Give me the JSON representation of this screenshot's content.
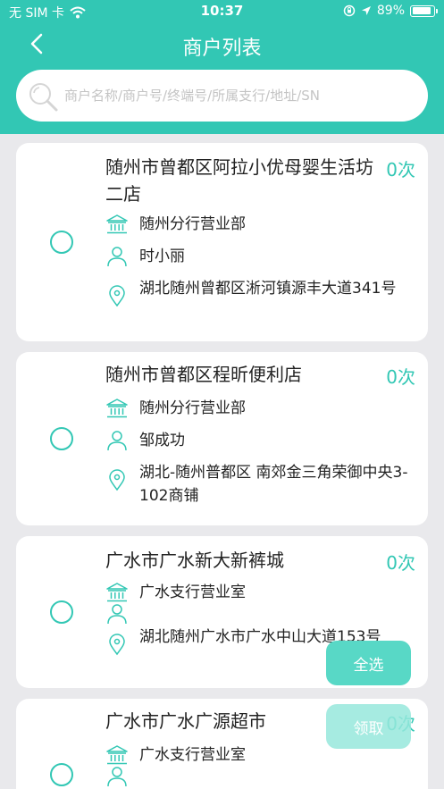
{
  "status_bar": {
    "carrier": "无 SIM 卡",
    "time": "10:37",
    "battery": "89%",
    "battery_level": 0.89
  },
  "nav": {
    "title": "商户列表",
    "back_icon": "chevron-left-icon"
  },
  "search": {
    "placeholder": "商户名称/商户号/终端号/所属支行/地址/SN",
    "value": ""
  },
  "merchants": [
    {
      "name": "随州市曾都区阿拉小优母婴生活坊二店",
      "count": "0次",
      "branch": "随州分行营业部",
      "contact": "时小丽",
      "address": "湖北随州曾都区淅河镇源丰大道341号"
    },
    {
      "name": "随州市曾都区程昕便利店",
      "count": "0次",
      "branch": "随州分行营业部",
      "contact": "邹成功",
      "address": "湖北-随州普都区 南郊金三角荣御中央3-102商铺"
    },
    {
      "name": "广水市广水新大新裤城",
      "count": "0次",
      "branch": "广水支行营业室",
      "contact": "",
      "address": "湖北随州广水市广水中山大道153号"
    },
    {
      "name": "广水市广水广源超市",
      "count": "0次",
      "branch": "广水支行营业室",
      "contact": "",
      "address": ""
    }
  ],
  "actions": {
    "select_all": "全选",
    "claim": "领取"
  },
  "colors": {
    "accent": "#32c7b4",
    "background": "#e9e9ec"
  }
}
